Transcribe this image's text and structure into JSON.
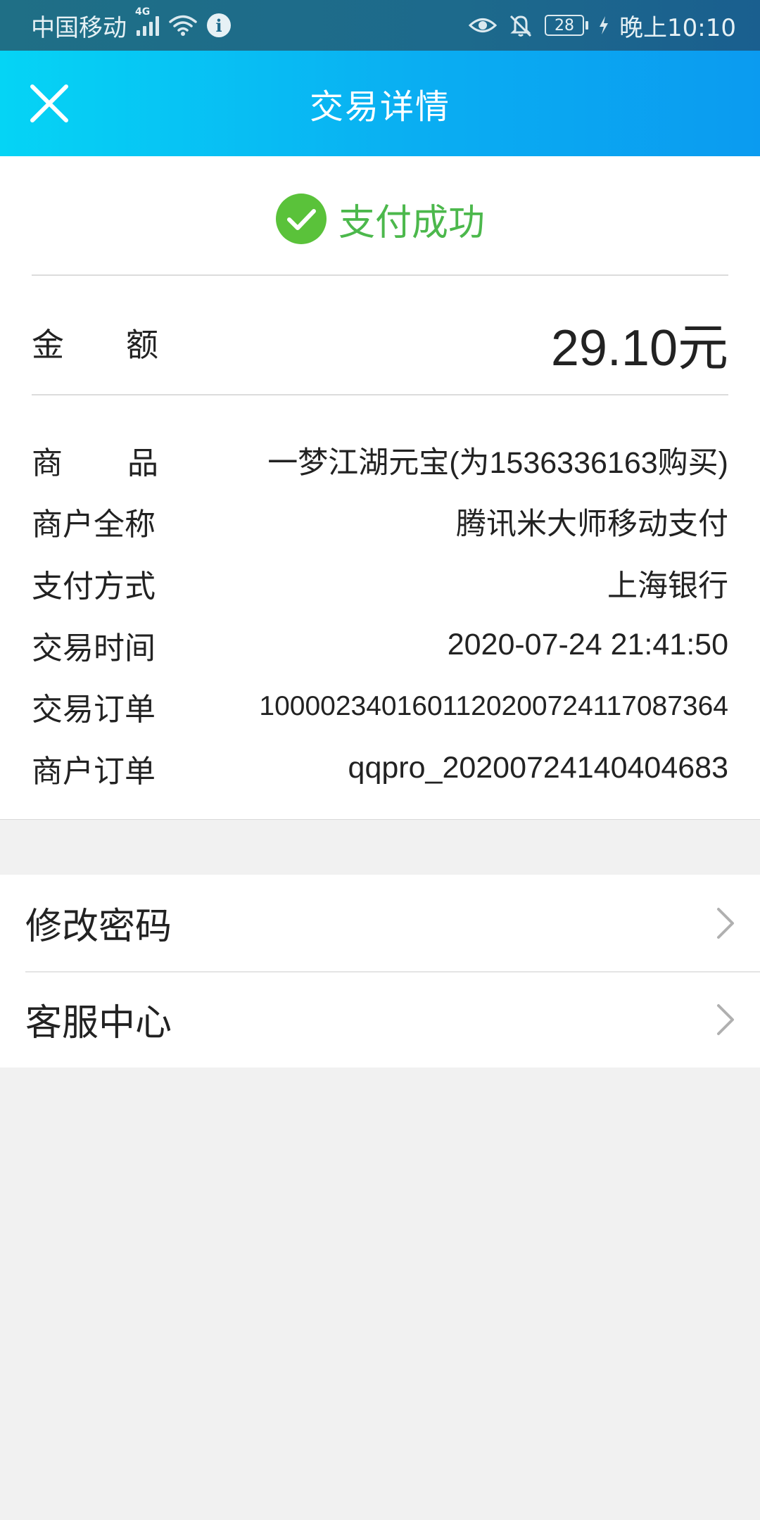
{
  "status_bar": {
    "carrier": "中国移动",
    "network": "4G",
    "battery": "28",
    "time": "晚上10:10"
  },
  "header": {
    "title": "交易详情"
  },
  "result": {
    "status": "支付成功",
    "status_color": "#4cb84c"
  },
  "amount": {
    "label_chars": [
      "金",
      "额"
    ],
    "value": "29.10元"
  },
  "details": {
    "product_label_chars": [
      "商",
      "品"
    ],
    "product": "一梦江湖元宝(为1536336163购买)",
    "rows": [
      {
        "label": "商户全称",
        "value": "腾讯米大师移动支付"
      },
      {
        "label": "支付方式",
        "value": "上海银行"
      },
      {
        "label": "交易时间",
        "value": "2020-07-24 21:41:50"
      },
      {
        "label": "交易订单",
        "value": "1000023401601120200724117087364"
      },
      {
        "label": "商户订单",
        "value": "qqpro_20200724140404683"
      }
    ]
  },
  "menu": {
    "items": [
      {
        "label": "修改密码"
      },
      {
        "label": "客服中心"
      }
    ]
  },
  "colors": {
    "header_gradient_start": "#05d4f5",
    "header_gradient_end": "#0b9bf0",
    "success_green": "#4cb84c",
    "page_background": "#f1f1f1"
  }
}
